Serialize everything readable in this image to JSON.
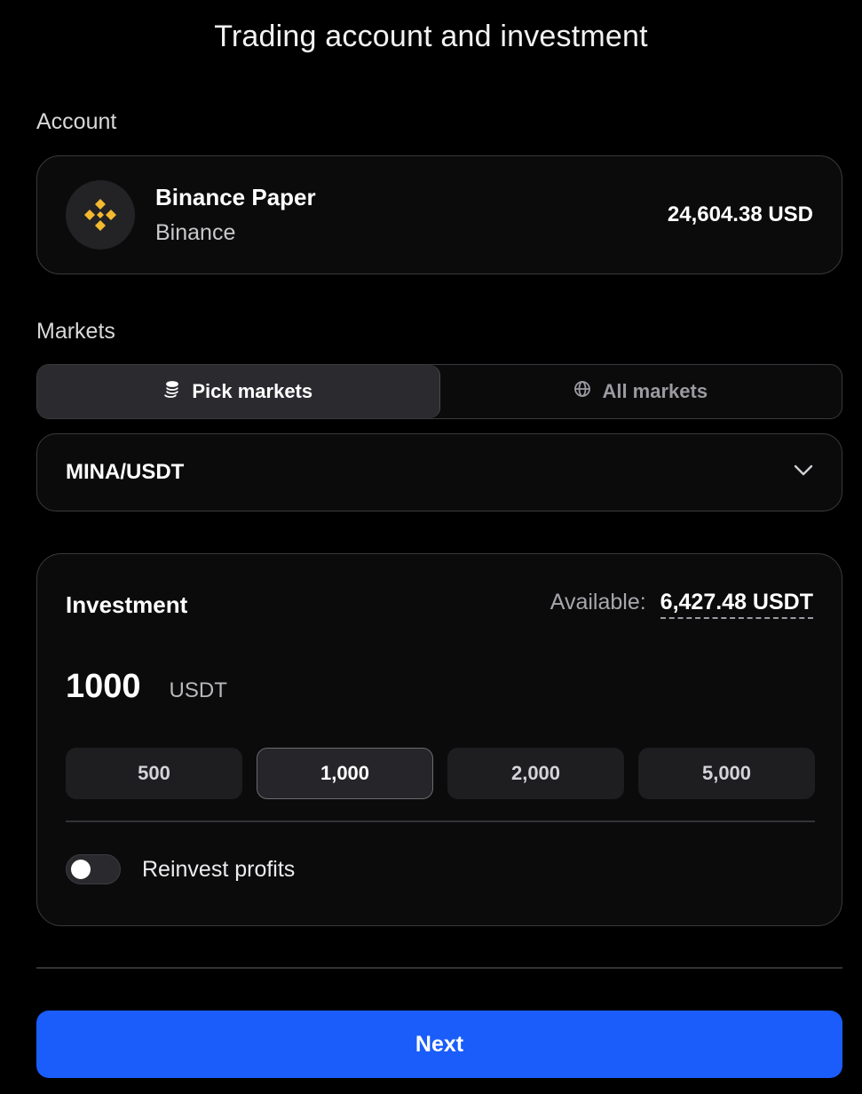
{
  "page": {
    "title": "Trading account and investment"
  },
  "account": {
    "section_label": "Account",
    "name": "Binance Paper",
    "exchange": "Binance",
    "balance": "24,604.38 USD",
    "logo_icon": "binance-logo-icon",
    "logo_color": "#F3BA2F"
  },
  "markets": {
    "section_label": "Markets",
    "tabs": [
      {
        "label": "Pick markets",
        "icon": "coins-stack-icon",
        "active": true
      },
      {
        "label": "All markets",
        "icon": "globe-icon",
        "active": false
      }
    ],
    "selected_market": "MINA/USDT"
  },
  "investment": {
    "title": "Investment",
    "available_label": "Available:",
    "available_value": "6,427.48 USDT",
    "amount": "1000",
    "unit": "USDT",
    "presets": [
      {
        "label": "500",
        "active": false
      },
      {
        "label": "1,000",
        "active": true
      },
      {
        "label": "2,000",
        "active": false
      },
      {
        "label": "5,000",
        "active": false
      }
    ],
    "reinvest_label": "Reinvest profits",
    "reinvest_enabled": false
  },
  "footer": {
    "next_label": "Next",
    "accent_color": "#1A5DFB"
  }
}
